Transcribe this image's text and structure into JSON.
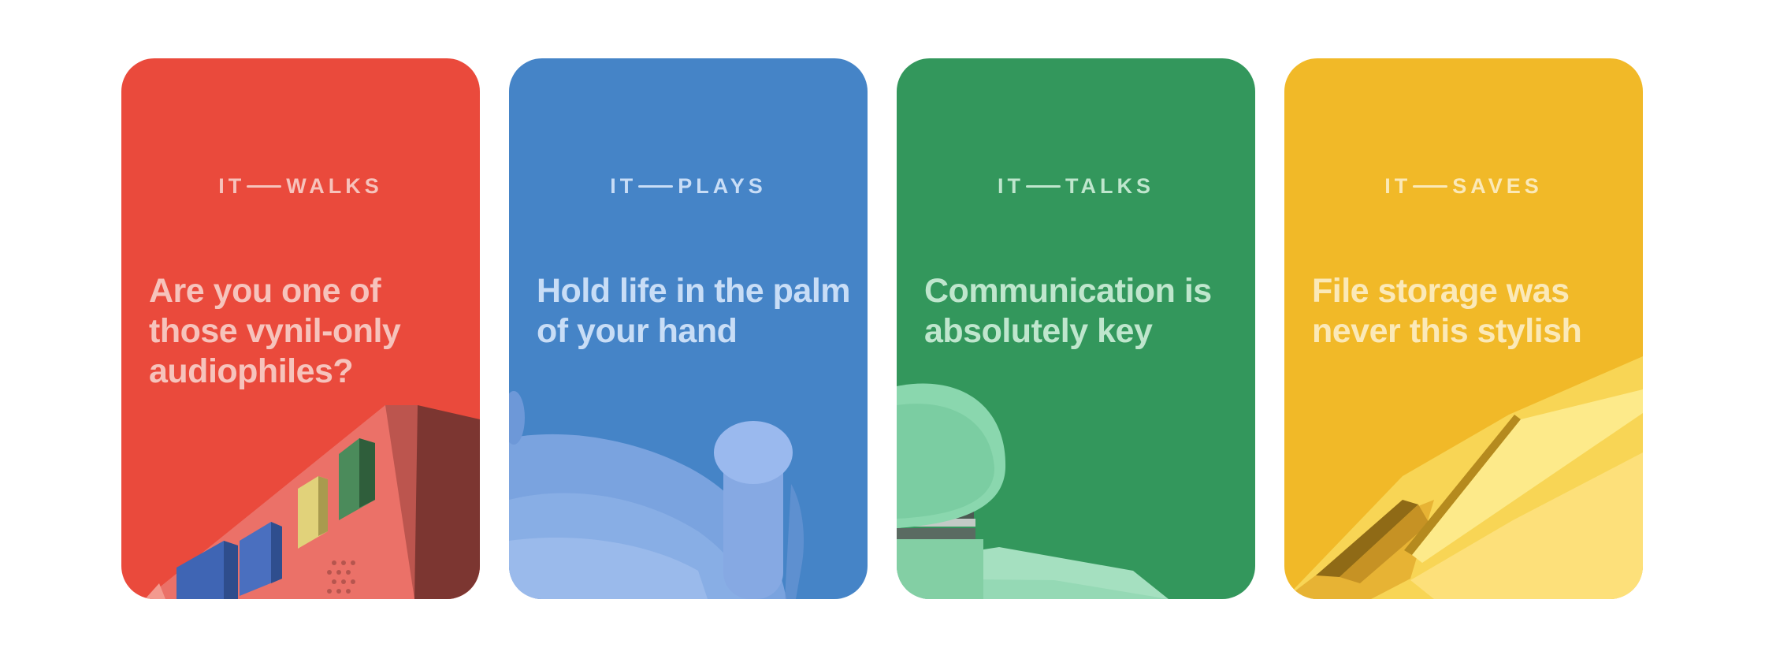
{
  "cards": [
    {
      "id": "walks",
      "eyebrow_prefix": "IT",
      "eyebrow_word": "WALKS",
      "headline": "Are you one of those vynil-only audiophiles?",
      "background": "#ea4a3c",
      "text_color": "#f6c3bc",
      "illustration": "red-music-box-illustration"
    },
    {
      "id": "plays",
      "eyebrow_prefix": "IT",
      "eyebrow_word": "PLAYS",
      "headline": "Hold life in the palm of your hand",
      "background": "#4584c7",
      "text_color": "#c8ddf6",
      "illustration": "blue-game-controller-illustration"
    },
    {
      "id": "talks",
      "eyebrow_prefix": "IT",
      "eyebrow_word": "TALKS",
      "headline": "Communication is absolutely key",
      "background": "#33975c",
      "text_color": "#bfe6cd",
      "illustration": "green-push-button-illustration"
    },
    {
      "id": "saves",
      "eyebrow_prefix": "IT",
      "eyebrow_word": "SAVES",
      "headline": "File storage was never this stylish",
      "background": "#f1b928",
      "text_color": "#fbe9b8",
      "illustration": "yellow-storage-card-illustration"
    }
  ]
}
